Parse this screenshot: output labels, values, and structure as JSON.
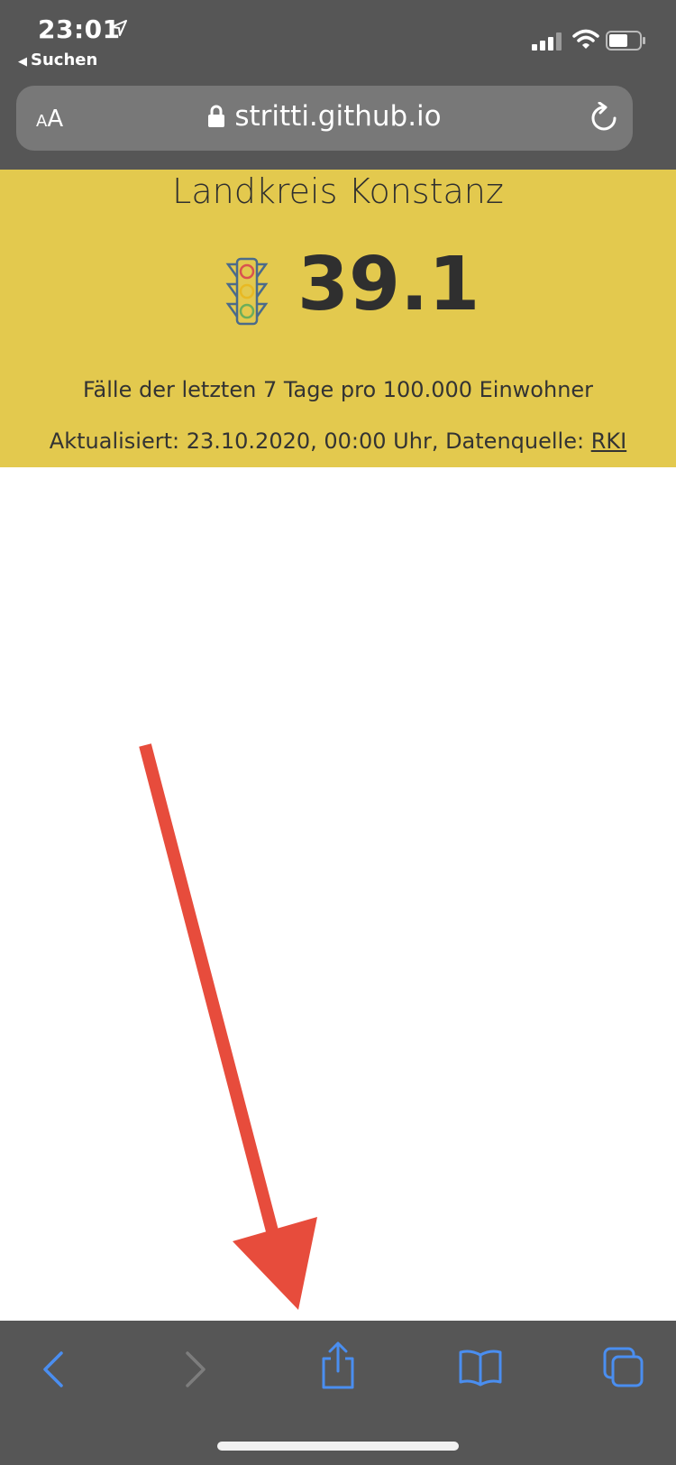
{
  "status_bar": {
    "time": "23:01",
    "back_app": "Suchen"
  },
  "browser": {
    "text_size_small": "A",
    "text_size_large": "A",
    "url": "stritti.github.io"
  },
  "page": {
    "title": "Landkreis Konstanz",
    "incidence_value": "39.1",
    "caption": "Fälle der letzten 7 Tage pro 100.000 Einwohner",
    "updated_prefix": "Aktualisiert: 23.10.2020, 00:00 Uhr, Datenquelle: ",
    "source_link": "RKI"
  },
  "colors": {
    "banner_yellow": "#e3c94e",
    "chrome_gray": "#565656",
    "toolbar_blue": "#4a8ef0",
    "annotation_red": "#e74c3c"
  },
  "toolbar": {
    "icons": [
      "back-icon",
      "forward-icon",
      "share-icon",
      "bookmarks-icon",
      "tabs-icon"
    ]
  }
}
